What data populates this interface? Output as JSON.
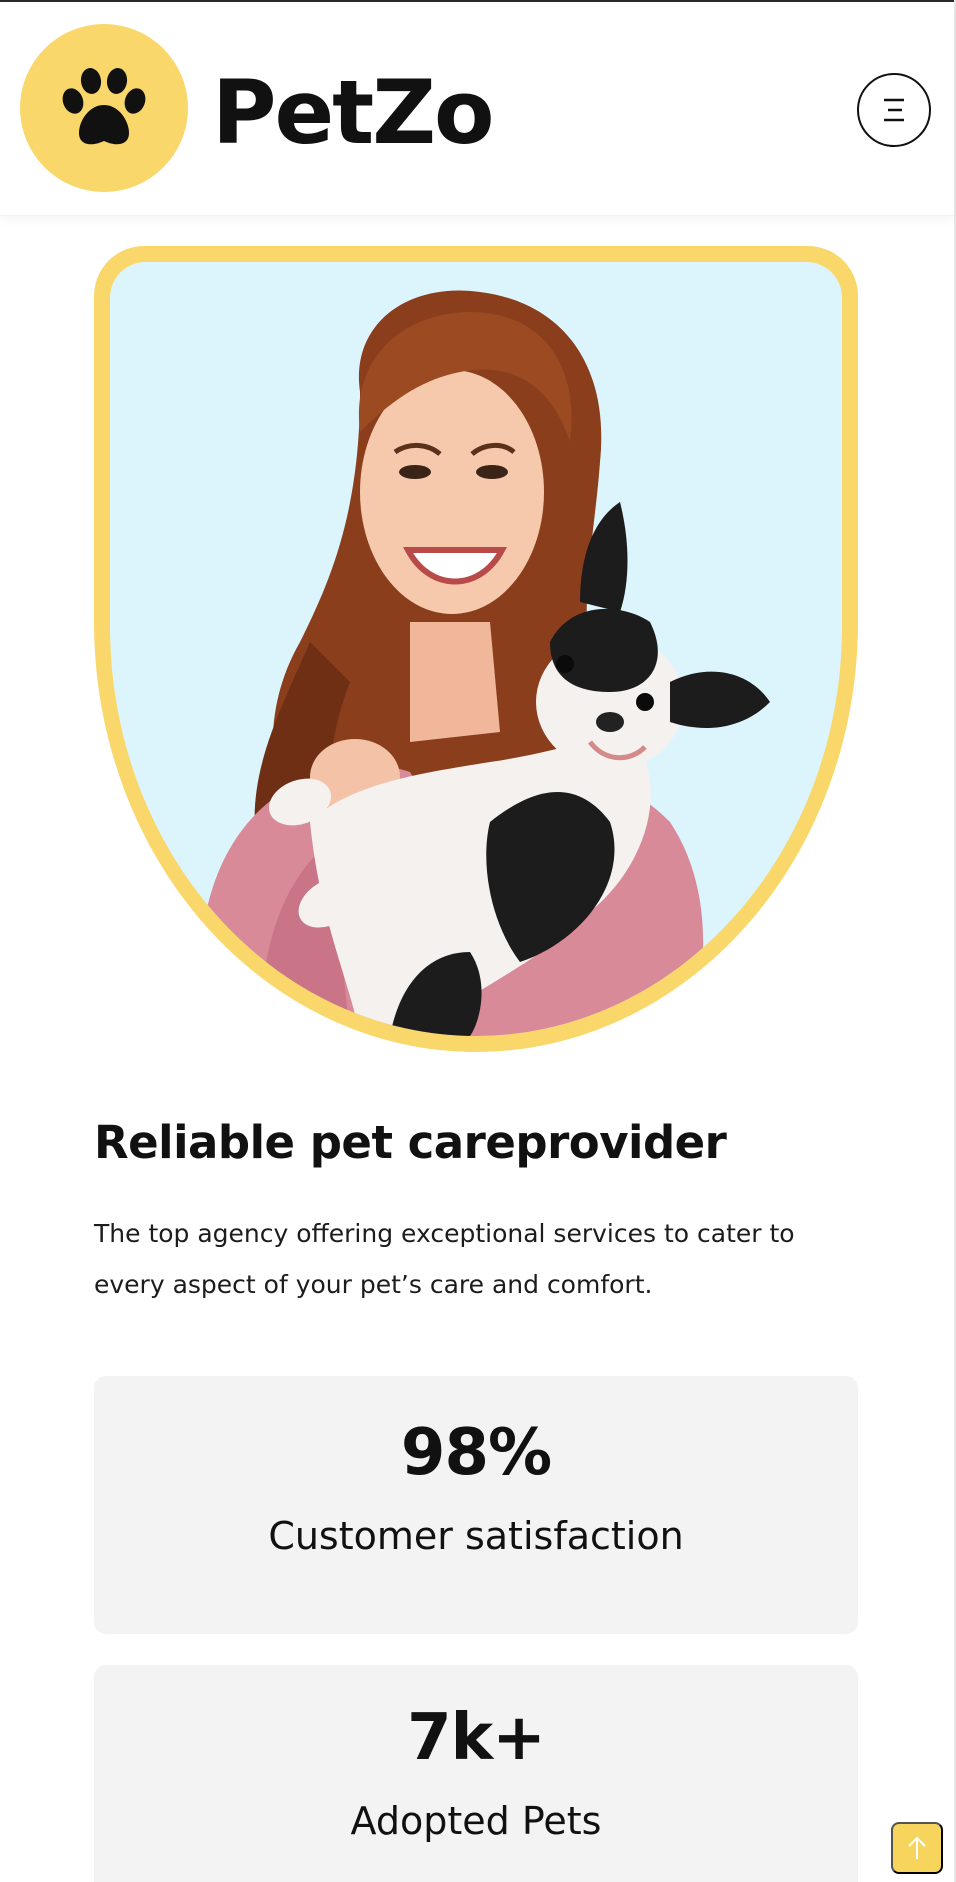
{
  "brand": {
    "name": "PetZo",
    "logo_icon": "paw-icon"
  },
  "header": {
    "menu_icon": "menu-icon"
  },
  "hero": {
    "image": "woman-holding-dog-photo"
  },
  "intro": {
    "heading": "Reliable pet careprovider",
    "description": "The top agency offering exceptional services to cater to every aspect of your pet’s care and comfort."
  },
  "stats": [
    {
      "value": "98%",
      "label": "Customer satisfaction"
    },
    {
      "value": "7k+",
      "label": "Adopted Pets"
    }
  ],
  "scroll_top": {
    "icon": "arrow-up-icon"
  },
  "colors": {
    "accent": "#f9d76a",
    "hero_background": "#dcf5fd",
    "card_background": "#f3f3f3",
    "text": "#111111"
  }
}
